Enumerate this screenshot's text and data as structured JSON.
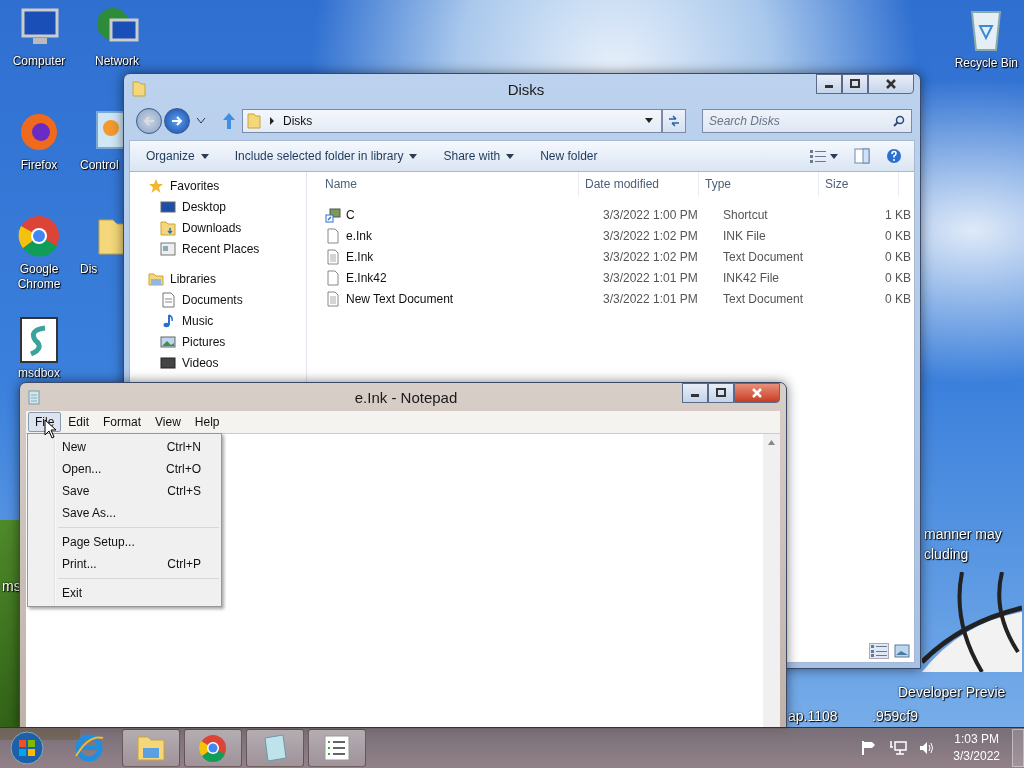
{
  "desktop_icons": [
    {
      "label": "Computer",
      "kind": "computer"
    },
    {
      "label": "Firefox",
      "kind": "firefox"
    },
    {
      "label": "Google Chrome",
      "kind": "chrome"
    },
    {
      "label": "msdbox",
      "kind": "script"
    },
    {
      "label": "Network",
      "kind": "network"
    },
    {
      "label": "Control",
      "kind": "control"
    },
    {
      "label": "Dis",
      "kind": "folder"
    }
  ],
  "recycle_bin": {
    "label": "Recycle Bin"
  },
  "desktop_texts": [
    "ms",
    "manner may",
    "cluding",
    "Developer Previe",
    "ap.1108",
    ".959cf9"
  ],
  "explorer": {
    "title": "Disks",
    "breadcrumb": "Disks",
    "search": {
      "placeholder": "Search Disks"
    },
    "toolbar": [
      {
        "label": "Organize",
        "dropdown": true
      },
      {
        "label": "Include selected folder in library",
        "dropdown": true
      },
      {
        "label": "Share with",
        "dropdown": true
      },
      {
        "label": "New folder",
        "dropdown": false
      }
    ],
    "nav_groups": [
      {
        "label": "Favorites",
        "kind": "star",
        "children": [
          {
            "label": "Desktop",
            "kind": "desktop"
          },
          {
            "label": "Downloads",
            "kind": "downloads"
          },
          {
            "label": "Recent Places",
            "kind": "recent"
          }
        ]
      },
      {
        "label": "Libraries",
        "kind": "library",
        "children": [
          {
            "label": "Documents",
            "kind": "documents"
          },
          {
            "label": "Music",
            "kind": "music"
          },
          {
            "label": "Pictures",
            "kind": "pictures"
          },
          {
            "label": "Videos",
            "kind": "videos"
          }
        ]
      }
    ],
    "columns": [
      "Name",
      "Date modified",
      "Type",
      "Size"
    ],
    "rows": [
      {
        "name": "C",
        "date": "3/3/2022 1:00 PM",
        "type": "Shortcut",
        "size": "1 KB",
        "kind": "shortcut"
      },
      {
        "name": "e.Ink",
        "date": "3/3/2022 1:02 PM",
        "type": "INK File",
        "size": "0 KB",
        "kind": "file"
      },
      {
        "name": "E.Ink",
        "date": "3/3/2022 1:02 PM",
        "type": "Text Document",
        "size": "0 KB",
        "kind": "text"
      },
      {
        "name": "E.Ink42",
        "date": "3/3/2022 1:01 PM",
        "type": "INK42 File",
        "size": "0 KB",
        "kind": "file"
      },
      {
        "name": "New Text Document",
        "date": "3/3/2022 1:01 PM",
        "type": "Text Document",
        "size": "0 KB",
        "kind": "text"
      }
    ]
  },
  "notepad": {
    "title": "e.Ink - Notepad",
    "menus": [
      {
        "label": "File",
        "selected": true
      },
      {
        "label": "Edit",
        "selected": false
      },
      {
        "label": "Format",
        "selected": false
      },
      {
        "label": "View",
        "selected": false
      },
      {
        "label": "Help",
        "selected": false
      }
    ],
    "file_menu": [
      {
        "kind": "item",
        "label": "New",
        "shortcut": "Ctrl+N"
      },
      {
        "kind": "item",
        "label": "Open...",
        "shortcut": "Ctrl+O"
      },
      {
        "kind": "item",
        "label": "Save",
        "shortcut": "Ctrl+S"
      },
      {
        "kind": "item",
        "label": "Save As..."
      },
      {
        "kind": "separator"
      },
      {
        "kind": "item",
        "label": "Page Setup..."
      },
      {
        "kind": "item",
        "label": "Print...",
        "shortcut": "Ctrl+P"
      },
      {
        "kind": "separator"
      },
      {
        "kind": "item",
        "label": "Exit"
      }
    ]
  },
  "taskbar": {
    "apps": [
      {
        "kind": "ie",
        "active": false
      },
      {
        "kind": "explorer",
        "active": true
      },
      {
        "kind": "chrome",
        "active": true
      },
      {
        "kind": "notepad",
        "active": true
      },
      {
        "kind": "list",
        "active": true
      }
    ],
    "time": "1:03 PM",
    "date": "3/3/2022"
  }
}
